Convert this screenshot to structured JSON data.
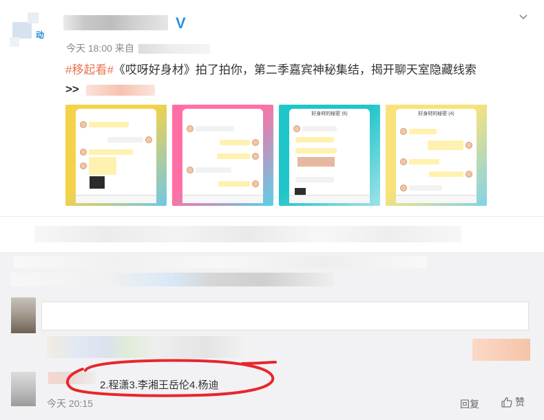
{
  "post": {
    "avatar_brand": "动",
    "time": "今天 18:00",
    "source_prefix": "来自",
    "tag": "#移起看#",
    "text": "《哎呀好身材》拍了拍你，第二季嘉宾神秘集结，揭开聊天室隐藏线索",
    "more": ">>"
  },
  "thumbnails": [
    {
      "title": "",
      "bg": "#f4d24a",
      "bg2": "#6ec7e8"
    },
    {
      "title": "",
      "bg": "#ff6fa5",
      "bg2": "#5ad1e8"
    },
    {
      "title": "好身材的秘密 (6)",
      "bg": "#1ec6c9",
      "bg2": "#9fe2e8"
    },
    {
      "title": "好身材的秘密 (4)",
      "bg": "#f9e27a",
      "bg2": "#7fd3ea"
    }
  ],
  "composer": {
    "send_label": ""
  },
  "reply": {
    "text": "2.程潇3.李湘王岳伦4.杨迪",
    "time": "今天 20:15",
    "reply_label": "回复",
    "like_label": "赞"
  },
  "colors": {
    "accent": "#eb7350",
    "verified": "#2f8fdb",
    "annotation": "#e8262b"
  }
}
